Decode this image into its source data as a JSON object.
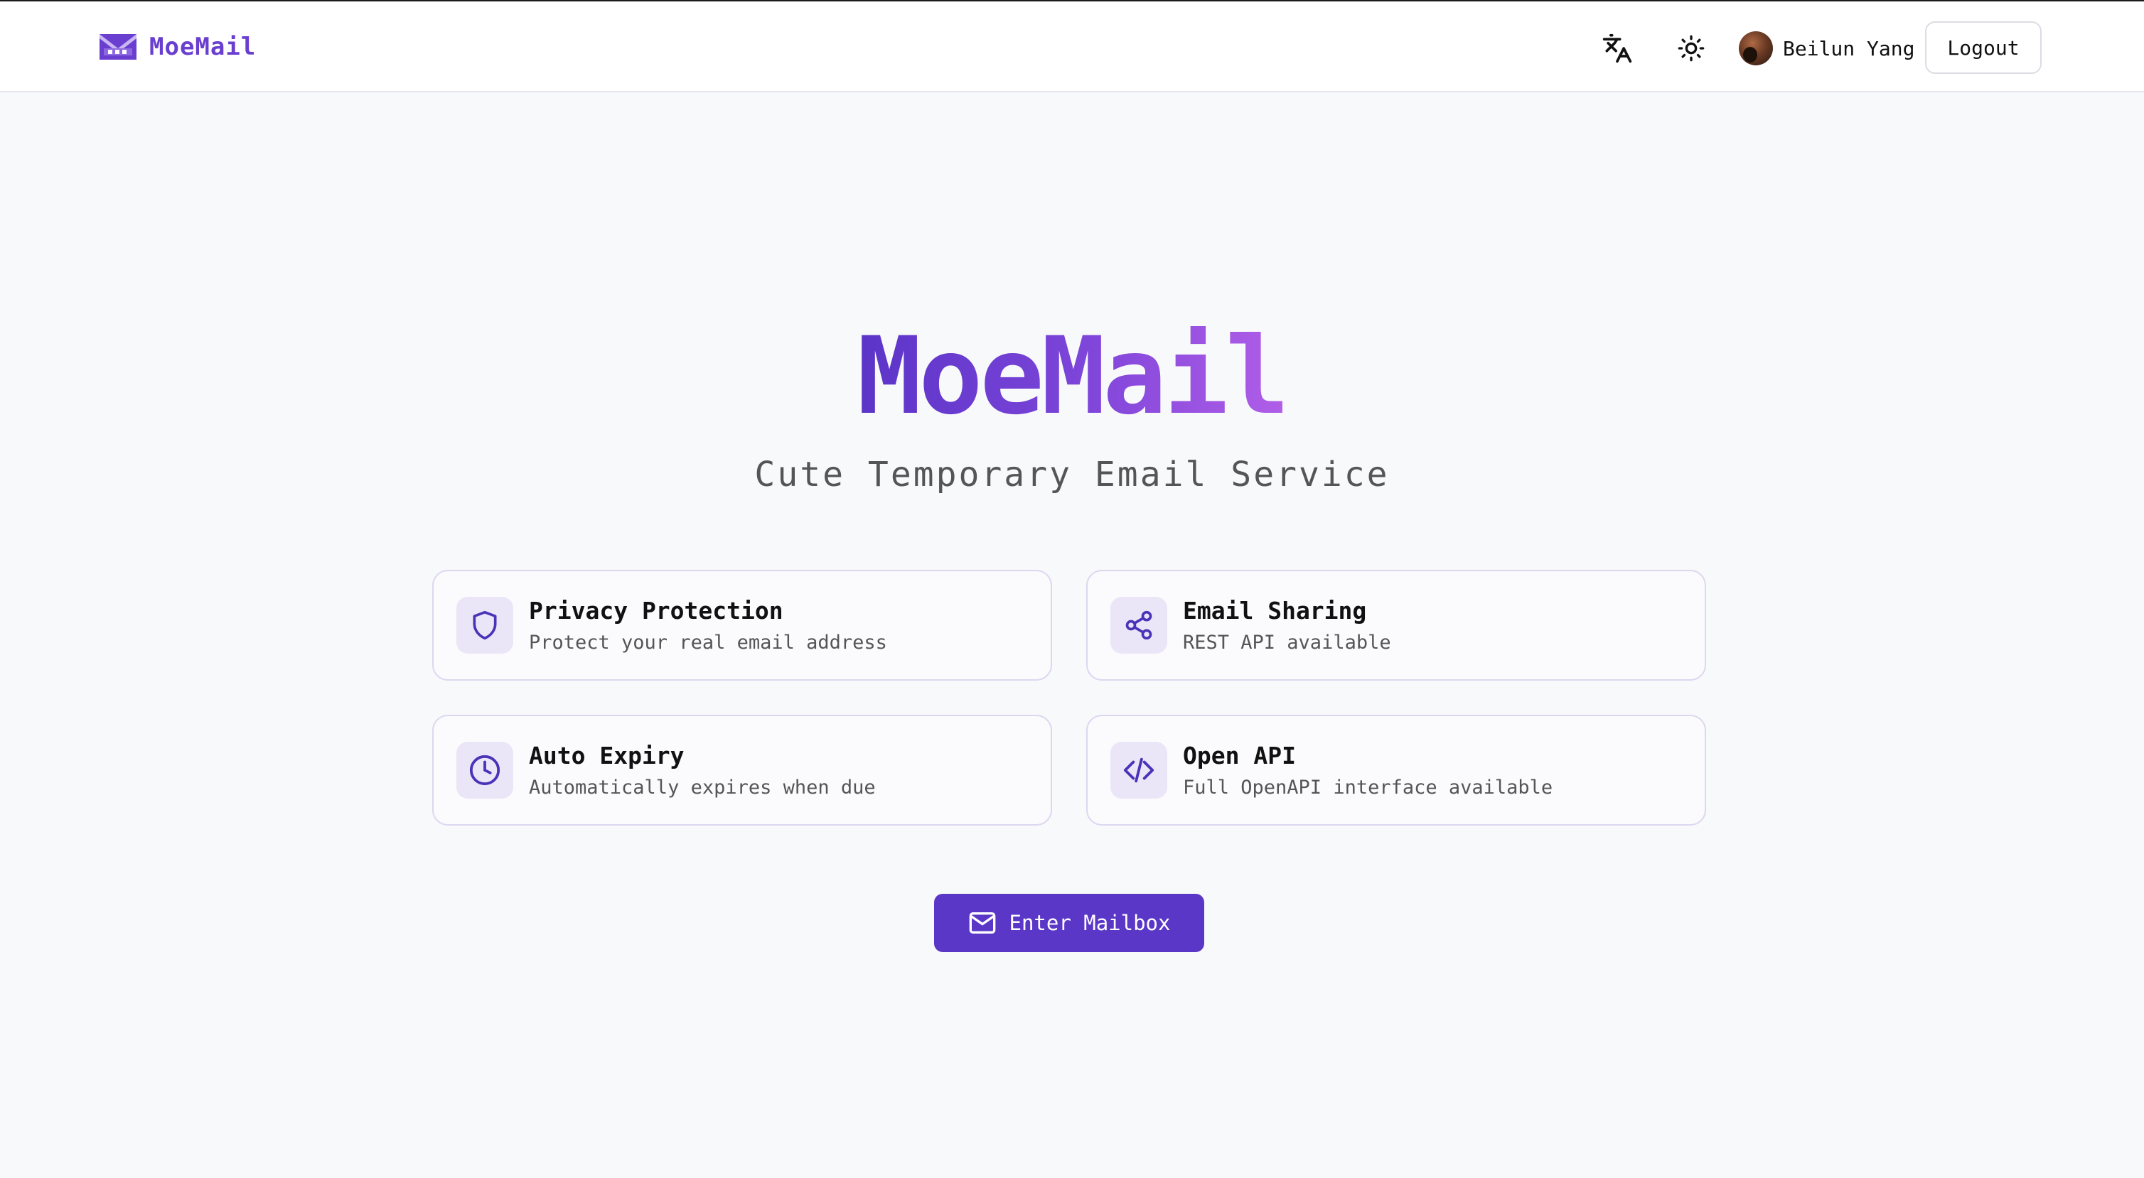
{
  "header": {
    "brand_name": "MoeMail",
    "user_name": "Beilun Yang",
    "logout_label": "Logout"
  },
  "hero": {
    "title": "MoeMail",
    "subtitle": "Cute Temporary Email Service"
  },
  "features": [
    {
      "title": "Privacy Protection",
      "description": "Protect your real email address",
      "icon": "shield-icon"
    },
    {
      "title": "Email Sharing",
      "description": "REST API available",
      "icon": "share-icon"
    },
    {
      "title": "Auto Expiry",
      "description": "Automatically expires when due",
      "icon": "clock-icon"
    },
    {
      "title": "Open API",
      "description": "Full OpenAPI interface available",
      "icon": "code-icon"
    }
  ],
  "cta": {
    "label": "Enter Mailbox"
  },
  "colors": {
    "brand": "#6a3fd0",
    "button": "#5b37c8",
    "icon_tint": "#4a33b8",
    "card_icon_bg": "#ebe6f7"
  }
}
